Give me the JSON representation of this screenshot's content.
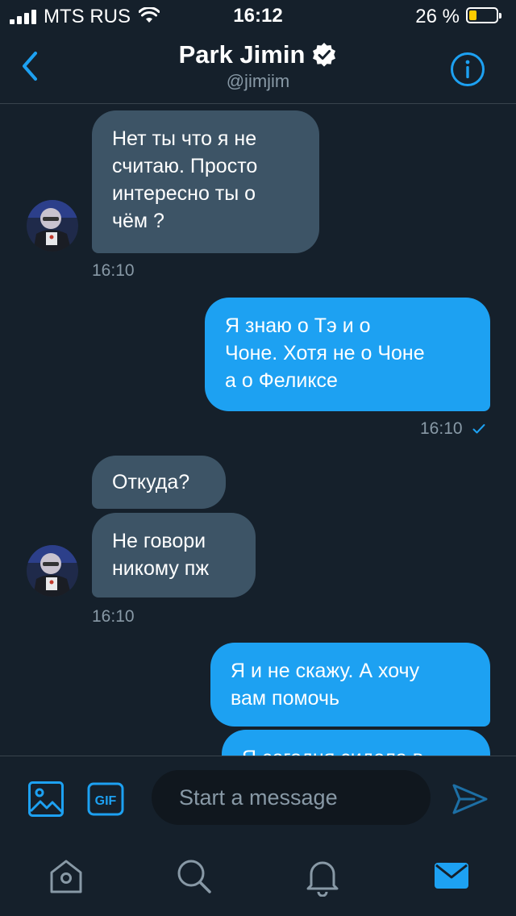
{
  "status_bar": {
    "carrier": "MTS RUS",
    "time": "16:12",
    "battery_percent": "26 %",
    "battery_level": 0.26,
    "icons": [
      "signal-icon",
      "wifi-icon",
      "battery-icon"
    ]
  },
  "header": {
    "name": "Park Jimin",
    "handle": "@jimjim",
    "verified": true,
    "icons": [
      "back-chevron-icon",
      "verified-badge-icon",
      "info-icon"
    ]
  },
  "messages": [
    {
      "direction": "in",
      "text": [
        "Нет ты что я не",
        "считаю. Просто",
        "интересно ты о",
        "чём ?"
      ]
    },
    {
      "direction": "in_time",
      "time": "16:10"
    },
    {
      "direction": "out",
      "text": [
        "Я знаю о Тэ и о",
        "Чоне. Хотя не о Чоне",
        "а о Феликсе"
      ]
    },
    {
      "direction": "out_time",
      "time": "16:10",
      "status": "read"
    },
    {
      "direction": "in",
      "text": [
        "Откуда?"
      ]
    },
    {
      "direction": "in",
      "text": [
        "Не говори",
        "никому пж"
      ]
    },
    {
      "direction": "in_time",
      "time": "16:10"
    },
    {
      "direction": "out",
      "text": [
        "Я и не скажу. А хочу",
        "вам помочь"
      ]
    },
    {
      "direction": "out",
      "text": [
        "Я сегодня сидела в"
      ]
    }
  ],
  "composer": {
    "placeholder": "Start a message",
    "gif_label": "GIF",
    "icons": [
      "image-icon",
      "gif-icon",
      "send-icon"
    ]
  },
  "tab_bar": {
    "items": [
      "home",
      "search",
      "notifications",
      "messages"
    ],
    "active": "messages"
  },
  "colors": {
    "background": "#15202b",
    "incoming_bubble": "#3d5466",
    "outgoing_bubble": "#1da1f2",
    "accent": "#1da1f2",
    "secondary_text": "#8899a6",
    "input_bg": "#10171e"
  }
}
